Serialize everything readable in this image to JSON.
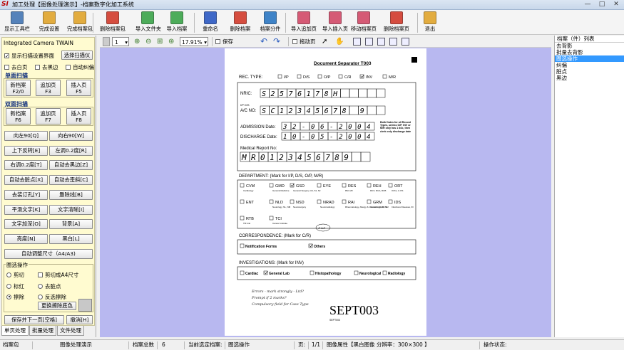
{
  "window": {
    "logo": "SI",
    "title": "加工处理【图像处理演示】-档案数字化加工系统",
    "minimize": "—",
    "maximize": "□",
    "close": "✕"
  },
  "toolbar": {
    "items": [
      {
        "label": "显示工具栏",
        "icon": "toolbar-icon",
        "color": "#3a6fb0"
      },
      {
        "label": "完成设置",
        "icon": "complete-settings-icon",
        "color": "#e0a020"
      },
      {
        "label": "完成档案包",
        "icon": "complete-package-icon",
        "color": "#e0a020"
      },
      {
        "label": "删除档案包",
        "icon": "delete-package-icon",
        "color": "#d03020"
      },
      {
        "label": "导入文件夹",
        "icon": "import-folder-icon",
        "color": "#30a040"
      },
      {
        "label": "导入档案",
        "icon": "import-archive-icon",
        "color": "#30a040"
      },
      {
        "label": "重命名",
        "icon": "rename-icon",
        "color": "#2050c0"
      },
      {
        "label": "删除档案",
        "icon": "delete-archive-icon",
        "color": "#d03020"
      },
      {
        "label": "档案分件",
        "icon": "split-archive-icon",
        "color": "#2070c0"
      },
      {
        "label": "导入追加页",
        "icon": "import-append-page-icon",
        "color": "#d04060"
      },
      {
        "label": "导入插入页",
        "icon": "import-insert-page-icon",
        "color": "#d04060"
      },
      {
        "label": "移动档案页",
        "icon": "move-page-icon",
        "color": "#d04060"
      },
      {
        "label": "删除档案页",
        "icon": "delete-page-icon",
        "color": "#d03020"
      },
      {
        "label": "退出",
        "icon": "exit-icon",
        "color": "#e0a020"
      }
    ]
  },
  "viewbar": {
    "page_value": "1",
    "zoom_value": "17.91%",
    "save_label": "保存",
    "drag_label": "拖动页"
  },
  "left": {
    "scanner": "Integrated Camera TWAIN",
    "show_scan_ui": "显示扫描设置界面",
    "choose_scanner": "选择扫描仪",
    "remove_white": "去白页",
    "remove_black": "去黑边",
    "auto_deskew": "自动纠偏",
    "single_scan": "单面扫描",
    "double_scan": "双面扫描",
    "new_archive_1": "新档案",
    "new_archive_1_key": "F2/0",
    "append_page_1": "追加页",
    "append_page_1_key": "F3",
    "insert_page_1": "插入页",
    "insert_page_1_key": "F5",
    "new_archive_2": "新档案",
    "new_archive_2_key": "F6",
    "append_page_2": "追加页",
    "append_page_2_key": "F7",
    "insert_page_2": "插入页",
    "insert_page_2_key": "F8",
    "ops": [
      "向左90[Q]",
      "向右90[W]",
      "上下反转[E]",
      "左调0.2度[R]",
      "右调0.2度[T]",
      "自动去黑边[Z]",
      "自动去脏点[X]",
      "自动去歪斜[C]",
      "去装订孔[Y]",
      "删除线[B]",
      "平滑文字[K]",
      "文字清晰[I]",
      "文字加深[O]",
      "背景[A]",
      "亮度[N]",
      "黑白[L]"
    ],
    "auto_size": "自动调整尺寸（A4/A3)",
    "crop_ops_title": "圈选操作",
    "cut": "剪切",
    "cut_a4": "剪切成A4尺寸",
    "mark_red": "标红",
    "remove_dots": "去脏点",
    "erase": "擦除",
    "inverse_erase": "反选擦除",
    "replace_color": "更换擦除底色",
    "save_next": "保存并下一页[空格]",
    "undo": "撤消[H]",
    "tabs": [
      "单页处理",
      "批量处理",
      "文件处理"
    ]
  },
  "document": {
    "title": "Document Separator T003",
    "rec_type": "REC. TYPE:",
    "rec_options": [
      "I/P",
      "D/S",
      "O/P",
      "C/R",
      "INV",
      "M/R"
    ],
    "nric_label": "NRIC:",
    "nric_value": "S2576178H",
    "ac_label_small": "I/P   D/S",
    "ac_label": "A/C NO:",
    "ac_value": "SC12345678 9",
    "admission_label": "ADMISSION Date:",
    "admission_value": "32-06-2004",
    "discharge_label": "DISCHARGE Date:",
    "discharge_value": "10-05-2004",
    "date_note": "Both Dates for all Record Types, unless O/P, INV or M/R only has 1 doc, then clerk only discharge date",
    "mrn_label": "Medical Report No:",
    "mrn_value": "MR0123456789",
    "dept_label": "DEPARTMENT: (Mark for I/P, D/S, O/P, M/R)",
    "departments": [
      {
        "code": "CVM",
        "sub": "Cardiology"
      },
      {
        "code": "GMD",
        "sub": "General Medicine"
      },
      {
        "code": "GSD",
        "sub": "General Surgery, GS, S1, S2"
      },
      {
        "code": "EYE",
        "sub": ""
      },
      {
        "code": "RES",
        "sub": "RM, M3"
      },
      {
        "code": "REH",
        "sub": "RCX, RCA, RCB"
      },
      {
        "code": "ORT",
        "sub": "Ortho, & OS"
      },
      {
        "code": "ENT",
        "sub": ""
      },
      {
        "code": "NLD",
        "sub": "Neurology, NL, NM"
      },
      {
        "code": "NSD",
        "sub": "Neurosurgery"
      },
      {
        "code": "NRAD",
        "sub": "Neuroradiology"
      },
      {
        "code": "RAI",
        "sub": "Rheumatology, Allergy & Immunology, RI, NM"
      },
      {
        "code": "GRM",
        "sub": "Geriatric Medicine"
      },
      {
        "code": "IDS",
        "sub": "Infectious Diseases, ID"
      },
      {
        "code": "RTB",
        "sub": "TB Unit"
      },
      {
        "code": "TCI",
        "sub": "Cancer Institute"
      }
    ],
    "corr_label": "CORRESPONDENCE: (Mark for C/R)",
    "corr_options": [
      "Notification Forms",
      "Others"
    ],
    "corr_handwritten": "A-LA",
    "inv_label": "INVESTIGATIONS: (Mark for INV)",
    "inv_options": [
      "Cardiac",
      "General Lab",
      "Histopathology",
      "Neurological",
      "Radiology"
    ],
    "handwriting": [
      "Errors - mark strongly - Ltd?",
      "Prompt if 2 marks?",
      "Compulsory field for Case Type"
    ],
    "stamp": "SEPT003",
    "footer_small": "SEPT003"
  },
  "right": {
    "header": "档案（件）列表",
    "items": [
      "去背影",
      "批量去背影",
      "圈选操作",
      "纠偏",
      "脏点",
      "黑边"
    ],
    "selected_index": 2
  },
  "status": {
    "package_label": "档案包",
    "package_value": "图像处理演示",
    "total_label": "档案总数",
    "total_value": "6",
    "current_label": "当前选定档案:",
    "current_value": "圈选操作",
    "page_label": "页:",
    "page_value": "1/1",
    "image_attr": "图像属性【黑白图像  分辨率：300×300 】",
    "op_status": "操作状态:"
  }
}
